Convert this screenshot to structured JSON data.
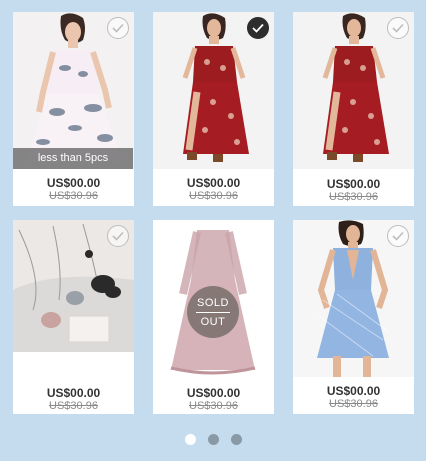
{
  "products": [
    {
      "price": "US$00.00",
      "original_price": "US$30.96",
      "selected": false,
      "badge": "less than 5pcs"
    },
    {
      "price": "US$00.00",
      "original_price": "US$30.96",
      "selected": true
    },
    {
      "price": "US$00.00",
      "original_price": "US$30.96",
      "selected": false
    },
    {
      "price": "US$00.00",
      "original_price": "US$30.96",
      "selected": false
    },
    {
      "price": "US$00.00",
      "original_price": "US$30.96",
      "selected": false,
      "sold_out": {
        "top": "SOLD",
        "bottom": "OUT"
      }
    },
    {
      "price": "US$00.00",
      "original_price": "US$30.96",
      "selected": false
    }
  ],
  "pagination": {
    "pages": 3,
    "current": 1
  },
  "colors": {
    "background": "#c5dcef",
    "selected_check": "#2d2d2d",
    "dot_active": "#ffffff",
    "dot_inactive": "#8a99a6"
  }
}
